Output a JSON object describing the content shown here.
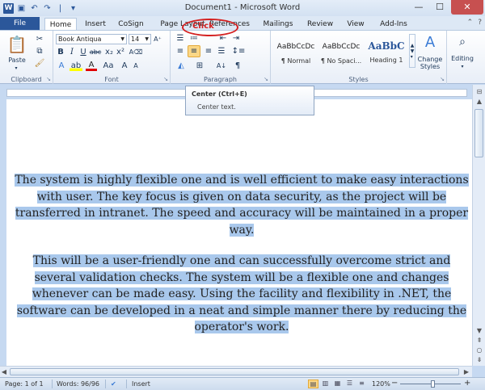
{
  "titlebar": {
    "title": "Document1 - Microsoft Word",
    "qat_separator": "|",
    "qat_more": "▾"
  },
  "tabs": [
    "File",
    "Home",
    "Insert",
    "CoSign",
    "Page Layout",
    "References",
    "Mailings",
    "Review",
    "View",
    "Add-Ins"
  ],
  "ribbon": {
    "clipboard": {
      "label": "Clipboard",
      "paste_label": "Paste"
    },
    "font": {
      "label": "Font",
      "font_name": "Book Antiqua",
      "font_size": "14"
    },
    "paragraph": {
      "label": "Paragraph"
    },
    "styles": {
      "label": "Styles",
      "items": [
        {
          "sample": "AaBbCcDc",
          "name": "¶ Normal"
        },
        {
          "sample": "AaBbCcDc",
          "name": "¶ No Spaci..."
        },
        {
          "sample": "AaBbC",
          "name": "Heading 1"
        }
      ],
      "change_styles_label": "Change Styles"
    },
    "editing": {
      "label": "Editing"
    }
  },
  "annotation": {
    "click_label": "Click"
  },
  "tooltip": {
    "title": "Center (Ctrl+E)",
    "description": "Center text."
  },
  "document": {
    "paragraphs": [
      "The system is highly flexible one and is well efficient to make easy interactions with user. The key focus is given on data security, as the project will be transferred in intranet. The speed and accuracy will be maintained in a proper way.",
      "This will be a user-friendly one and can successfully overcome strict and several validation checks. The system will be a flexible one and changes whenever can be made easy. Using the facility and flexibility in .NET, the software can be developed in a neat and simple manner there by reducing the operator's work."
    ]
  },
  "statusbar": {
    "page": "Page: 1 of 1",
    "words": "Words: 96/96",
    "mode": "Insert",
    "zoom": "120%",
    "zoom_minus": "−",
    "zoom_plus": "+"
  }
}
